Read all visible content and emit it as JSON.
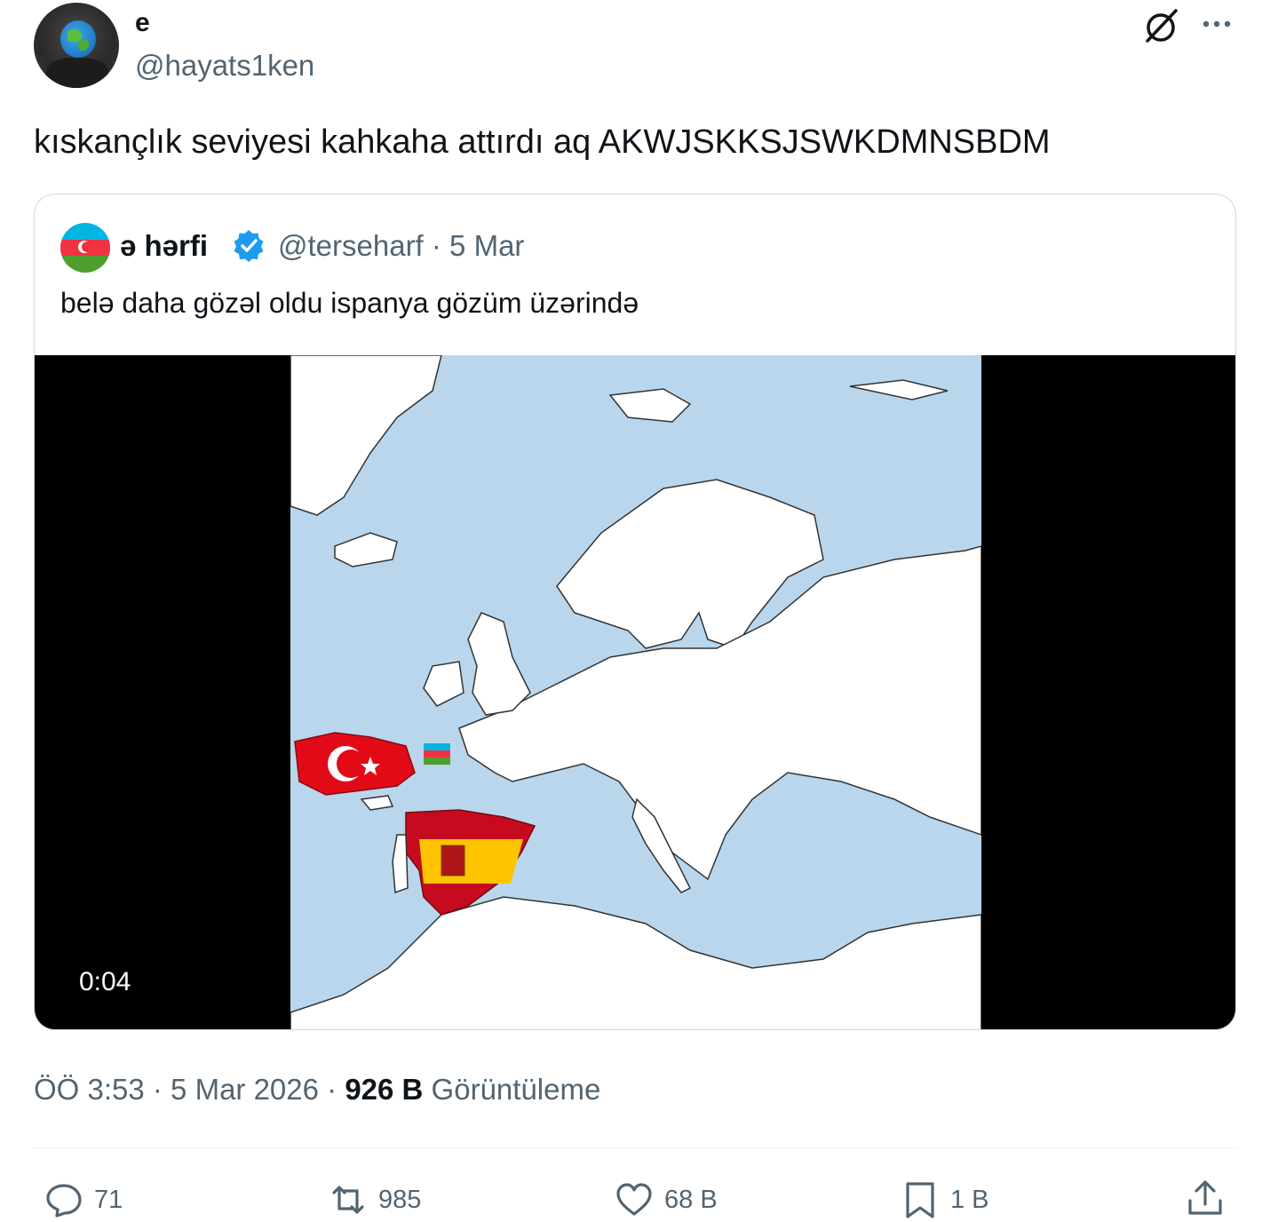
{
  "tweet": {
    "author": {
      "display_name": "e",
      "handle": "@hayats1ken",
      "avatar_icon": "globe-avatar"
    },
    "text": "kıskançlık seviyesi kahkaha attırdı aq AKWJSKKSJSWKDMNSBDM",
    "header_icons": [
      "grok-icon",
      "more-icon"
    ]
  },
  "quote": {
    "author": {
      "display_name": "ə hərfi",
      "handle_date": "@terseharf · 5 Mar",
      "verified": true,
      "avatar_icon": "azerbaijan-flag"
    },
    "text": "belə daha gözəl oldu ispanya gözüm üzərində",
    "video": {
      "duration": "0:04"
    }
  },
  "meta": {
    "time": "ÖÖ 3:53 · 5 Mar 2026 · ",
    "views_count": "926 B",
    "views_label": " Görüntüleme"
  },
  "actions": {
    "replies": "71",
    "reposts": "985",
    "likes": "68 B",
    "bookmarks": "1 B"
  },
  "colors": {
    "text": "#0f1419",
    "secondary": "#536471",
    "verified": "#1d9bf0",
    "border": "#cfd9de"
  }
}
